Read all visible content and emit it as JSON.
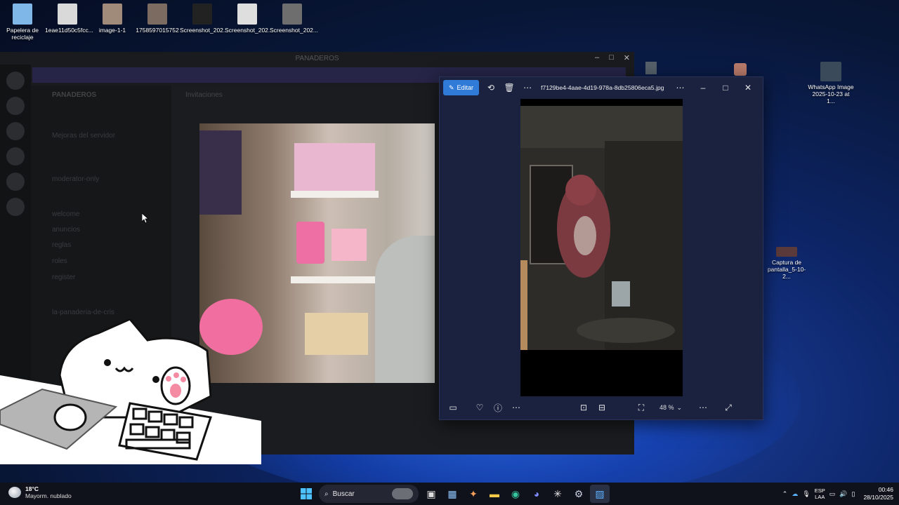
{
  "desktop": {
    "icons": [
      {
        "label": "Papelera de reciclaje",
        "color": "#7fb8e8"
      },
      {
        "label": "1eae11d50c5fcc...",
        "color": "#d9d9d9"
      },
      {
        "label": "image-1-1",
        "color": "#a08a7a"
      },
      {
        "label": "1758597015752",
        "color": "#7b6b60"
      },
      {
        "label": "Screenshot_202...",
        "color": "#222222"
      },
      {
        "label": "Screenshot_202...",
        "color": "#dedede"
      },
      {
        "label": "Screenshot_202...",
        "color": "#6e6e6e"
      }
    ],
    "right_icons": [
      {
        "label": "WhatsApp Image 2025-10-23 at 1...",
        "color": "#3b4a5a"
      },
      {
        "label": "Captura de pantalla_5-10-2...",
        "color": "#5a3a3a"
      }
    ]
  },
  "discord": {
    "title": "PANADEROS",
    "server_name": "PANADEROS",
    "channels": [
      "Mejoras del servidor",
      "moderator-only",
      "welcome",
      "anuncios",
      "reglas",
      "roles",
      "register",
      "la-panaderia-de-cris"
    ],
    "chat_header": "Invitaciones"
  },
  "viewer": {
    "edit_label": "Editar",
    "filename": "f7129be4-4aae-4d19-978a-8db25806eca5.jpg",
    "zoom": "48 %"
  },
  "taskbar": {
    "temperature": "18°C",
    "weather": "Mayorm. nublado",
    "search_label": "Buscar",
    "lang_top": "ESP",
    "lang_bottom": "LAA",
    "time": "00:46",
    "date": "28/10/2025"
  }
}
